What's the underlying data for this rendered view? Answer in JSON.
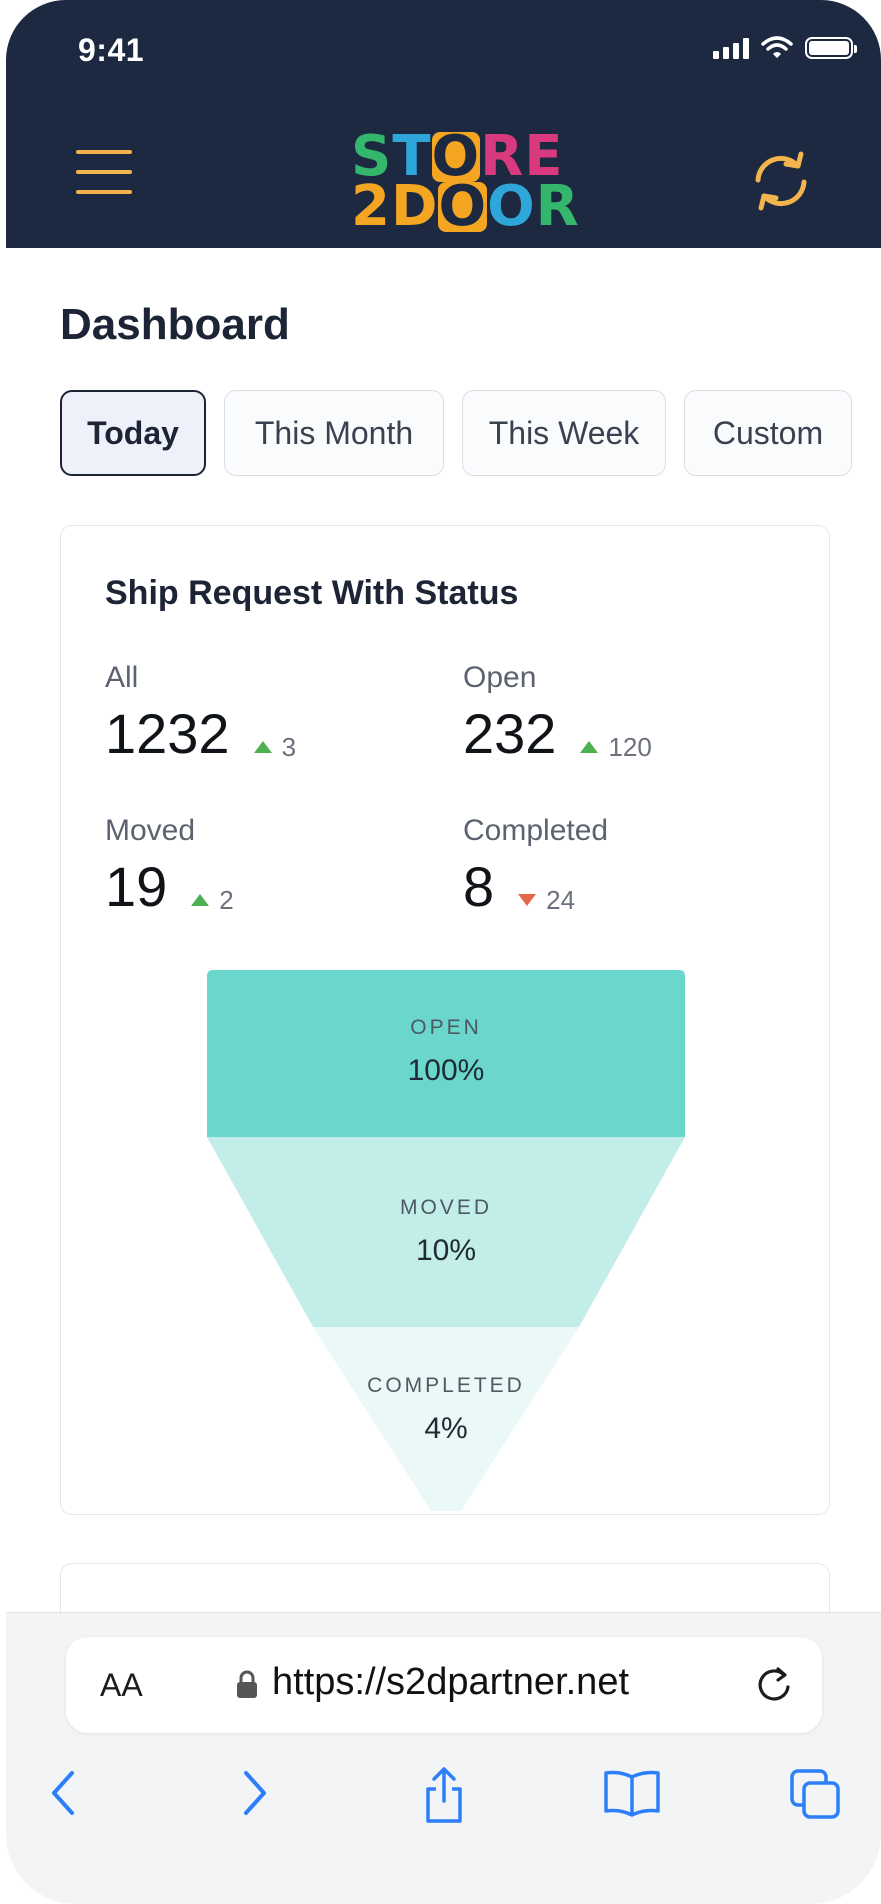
{
  "status_bar": {
    "time": "9:41"
  },
  "header": {
    "logo": {
      "line1": [
        "S",
        "T",
        "O",
        "R",
        "E"
      ],
      "line2": [
        "2",
        "D",
        "O",
        "O",
        "R"
      ]
    },
    "logo_colors": {
      "line1": [
        "#34b76d",
        "#2ea6da",
        "#f4a623",
        "#d93a7d",
        "#d93a7d"
      ],
      "line2": [
        "#f4a623",
        "#f4a623",
        "#1c2940",
        "#2ea6da",
        "#34b76d"
      ]
    }
  },
  "page": {
    "title": "Dashboard",
    "tabs": [
      {
        "label": "Today",
        "active": true
      },
      {
        "label": "This Month",
        "active": false
      },
      {
        "label": "This Week",
        "active": false
      },
      {
        "label": "Custom",
        "active": false
      }
    ]
  },
  "ship_card": {
    "title": "Ship Request With Status",
    "stats": [
      {
        "label": "All",
        "value": "1232",
        "delta": "3",
        "trend": "up"
      },
      {
        "label": "Open",
        "value": "232",
        "delta": "120",
        "trend": "up"
      },
      {
        "label": "Moved",
        "value": "19",
        "delta": "2",
        "trend": "up"
      },
      {
        "label": "Completed",
        "value": "8",
        "delta": "24",
        "trend": "down"
      }
    ],
    "funnel": [
      {
        "stage": "OPEN",
        "percent": "100%",
        "color": "#6ad6cc"
      },
      {
        "stage": "MOVED",
        "percent": "10%",
        "color": "#c3ede8"
      },
      {
        "stage": "COMPLETED",
        "percent": "4%",
        "color": "#eaf8f7"
      }
    ]
  },
  "browser": {
    "text_size_label": "AA",
    "url": "https://s2dpartner.net"
  },
  "colors": {
    "header_bg": "#1c2940",
    "accent": "#f2b44c",
    "up": "#4caf50",
    "down": "#e4694b"
  }
}
